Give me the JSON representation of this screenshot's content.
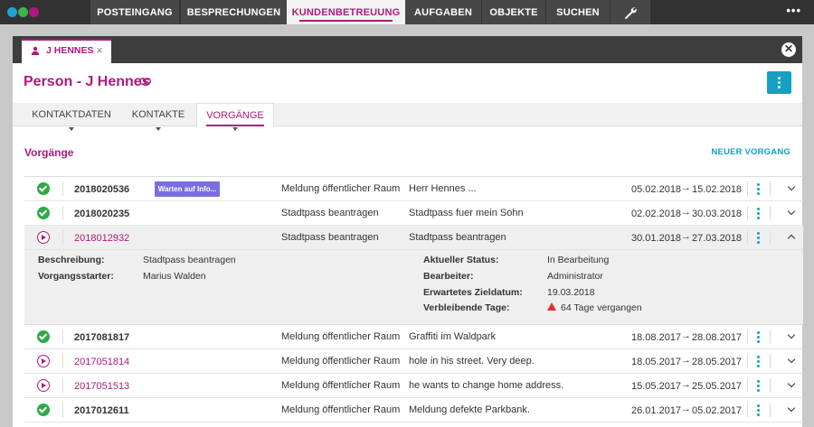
{
  "nav": {
    "items": [
      "POSTEINGANG",
      "BESPRECHUNGEN",
      "KUNDENBETREUUNG",
      "AUFGABEN",
      "OBJEKTE",
      "SUCHEN"
    ],
    "active": "KUNDENBETREUUNG",
    "more": "•••",
    "tool_icon": "wrench-icon",
    "logo_colors": [
      "#1fa3d4",
      "#3cb54a",
      "#b0197e"
    ]
  },
  "tab": {
    "label": "J HENNES",
    "close": "×"
  },
  "page": {
    "title": "Person - J Hennes"
  },
  "subtabs": [
    "KONTAKTDATEN",
    "KONTAKTE",
    "VORGÄNGE"
  ],
  "section": {
    "title": "Vorgänge",
    "new_button": "NEUER VORGANG"
  },
  "rows": [
    {
      "status": "done",
      "number": "2018020536",
      "badge": "Warten auf Info...",
      "category": "Meldung öffentlicher Raum",
      "description": "Herr Hennes ...",
      "from": "05.02.2018",
      "to": "15.02.2018"
    },
    {
      "status": "done",
      "number": "2018020235",
      "badge": "",
      "category": "Stadtpass beantragen",
      "description": "Stadtpass fuer mein Sohn",
      "from": "02.02.2018",
      "to": "30.03.2018"
    },
    {
      "status": "progress",
      "number": "2018012932",
      "badge": "",
      "category": "Stadtpass beantragen",
      "description": "Stadtpass beantragen",
      "from": "30.01.2018",
      "to": "27.03.2018"
    },
    {
      "status": "done",
      "number": "2017081817",
      "badge": "",
      "category": "Meldung öffentlicher Raum",
      "description": "Graffiti im Waldpark",
      "from": "18.08.2017",
      "to": "28.08.2017"
    },
    {
      "status": "progress",
      "number": "2017051814",
      "badge": "",
      "category": "Meldung öffentlicher Raum",
      "description": "hole in his street. Very deep.",
      "from": "18.05.2017",
      "to": "28.05.2017"
    },
    {
      "status": "progress",
      "number": "2017051513",
      "badge": "",
      "category": "Meldung öffentlicher Raum",
      "description": "he wants to change home address.",
      "from": "15.05.2017",
      "to": "25.05.2017"
    },
    {
      "status": "done",
      "number": "2017012611",
      "badge": "",
      "category": "Meldung öffentlicher Raum",
      "description": "Meldung defekte Parkbank.",
      "from": "26.01.2017",
      "to": "05.02.2017"
    }
  ],
  "arrow": "→",
  "detail": {
    "beschreibung_label": "Beschreibung:",
    "beschreibung": "Stadtpass beantragen",
    "starter_label": "Vorgangsstarter:",
    "starter": "Marius Walden",
    "status_label": "Aktueller Status:",
    "status": "In Bearbeitung",
    "bearbeiter_label": "Bearbeiter:",
    "bearbeiter": "Administrator",
    "zieldatum_label": "Erwartetes Zieldatum:",
    "zieldatum": "19.03.2018",
    "tage_label": "Verbleibende Tage:",
    "tage": "64 Tage vergangen"
  }
}
